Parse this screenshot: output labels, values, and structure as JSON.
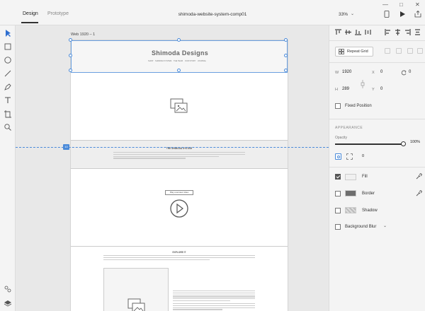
{
  "titlebar": {
    "tabs": [
      {
        "label": "Design"
      },
      {
        "label": "Prototype"
      }
    ],
    "document_title": "shimoda-website-system-comp01",
    "zoom": "33%",
    "window_controls": [
      "minimize",
      "maximize",
      "close"
    ]
  },
  "toolbar_left": {
    "tools": [
      "select-icon",
      "rectangle-icon",
      "ellipse-icon",
      "line-icon",
      "pen-icon",
      "text-icon",
      "artboard-icon",
      "zoom-icon"
    ],
    "bottom": [
      "plugins-icon",
      "layers-icon"
    ]
  },
  "canvas": {
    "artboard_label": "Web 1920 – 1",
    "header": {
      "brand": "Shimoda Designs",
      "nav": [
        "SHOP",
        "SHIMODA SYSTEM",
        "THE TEAM",
        "OUR STORY",
        "JOURNAL"
      ]
    },
    "section2_title": "THE SHIMODA SYSTEM",
    "video_button": "Play overview video",
    "section4_title": "EXPLORE IT",
    "guide_tag": "10"
  },
  "panel": {
    "repeat_grid": "Repeat Grid",
    "w_label": "W",
    "w_value": "1920",
    "x_label": "X",
    "x_value": "0",
    "rotate_value": "0",
    "h_label": "H",
    "h_value": "289",
    "y_label": "Y",
    "y_value": "0",
    "fixed_position": "Fixed Position",
    "appearance_heading": "APPEARANCE",
    "opacity_label": "Opacity",
    "opacity_value": "100%",
    "opacity_level": 1.0,
    "corner_value": "0",
    "fill_label": "Fill",
    "fill_checked": true,
    "fill_color": "#f0f0f0",
    "border_label": "Border",
    "border_checked": false,
    "border_color": "#6e6e6e",
    "shadow_label": "Shadow",
    "shadow_checked": false,
    "blur_label": "Background Blur",
    "blur_checked": false,
    "accent_color": "#4a8ad9"
  }
}
